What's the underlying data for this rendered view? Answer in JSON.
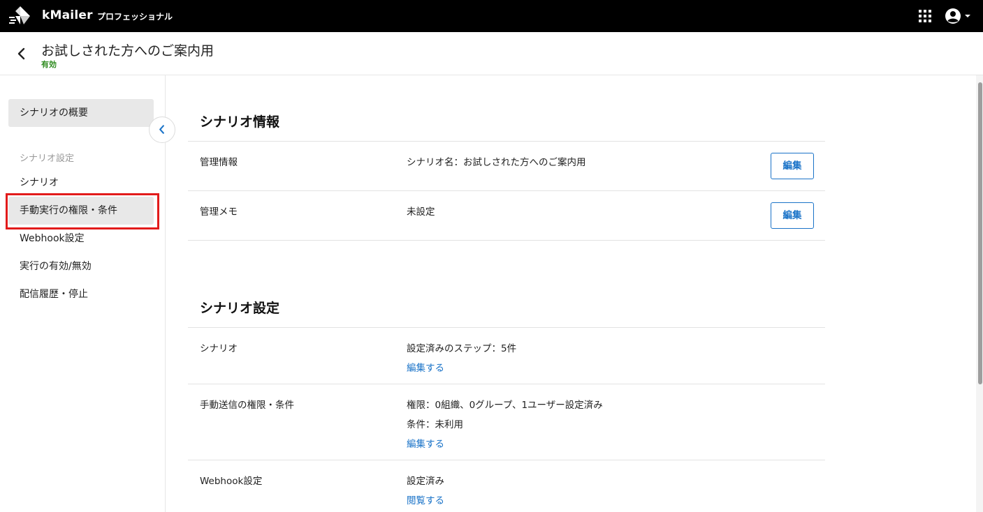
{
  "app": {
    "brand": "kMailer",
    "plan": "プロフェッショナル",
    "icons": {
      "logo": "kmailer-logo-icon",
      "apps": "apps-grid-icon",
      "user": "account-circle-icon",
      "dropdown": "caret-down-icon"
    }
  },
  "header": {
    "title": "お試しされた方へのご案内用",
    "status": "有効",
    "status_color": "#2e8b1f"
  },
  "sidebar": {
    "overview": "シナリオの概要",
    "group_label": "シナリオ設定",
    "items": [
      {
        "label": "シナリオ"
      },
      {
        "label": "手動実行の権限・条件"
      },
      {
        "label": "Webhook設定"
      },
      {
        "label": "実行の有効/無効"
      },
      {
        "label": "配信履歴・停止"
      }
    ],
    "highlight_color": "#e21b1b"
  },
  "sections": {
    "info": {
      "title": "シナリオ情報",
      "rows": [
        {
          "label": "管理情報",
          "value": "シナリオ名：お試しされた方へのご案内用",
          "button": "編集"
        },
        {
          "label": "管理メモ",
          "value": "未設定",
          "button": "編集"
        }
      ]
    },
    "settings": {
      "title": "シナリオ設定",
      "rows": [
        {
          "label": "シナリオ",
          "values": [
            "設定済みのステップ：5件"
          ],
          "link": "編集する"
        },
        {
          "label": "手動送信の権限・条件",
          "values": [
            "権限：0組織、0グループ、1ユーザー設定済み",
            "条件：未利用"
          ],
          "link": "編集する"
        },
        {
          "label": "Webhook設定",
          "values": [
            "設定済み"
          ],
          "link": "閲覧する"
        }
      ]
    }
  },
  "colors": {
    "accent": "#1a73c8",
    "topbar": "#000000"
  }
}
